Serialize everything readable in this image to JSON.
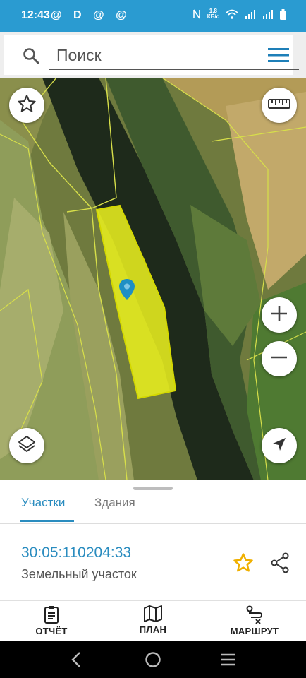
{
  "status_bar": {
    "time": "12:43",
    "left_icons": "@ D @ @",
    "net_speed_value": "1,8",
    "net_speed_unit": "КБ/с"
  },
  "search": {
    "placeholder": "Поиск",
    "value": ""
  },
  "map": {
    "selected_plot_color": "#e8ee1f",
    "boundary_color": "#d7df4a",
    "marker_color": "#1e8fc4"
  },
  "tabs": [
    {
      "label": "Участки",
      "active": true
    },
    {
      "label": "Здания",
      "active": false
    }
  ],
  "plot": {
    "cadastral_number": "30:05:110204:33",
    "type": "Земельный участок"
  },
  "actions": {
    "report": "ОТЧЁТ",
    "plan": "ПЛАН",
    "route": "МАРШРУТ"
  },
  "colors": {
    "accent": "#2a9bd1",
    "link": "#2a8cbf",
    "star": "#f0b000"
  }
}
